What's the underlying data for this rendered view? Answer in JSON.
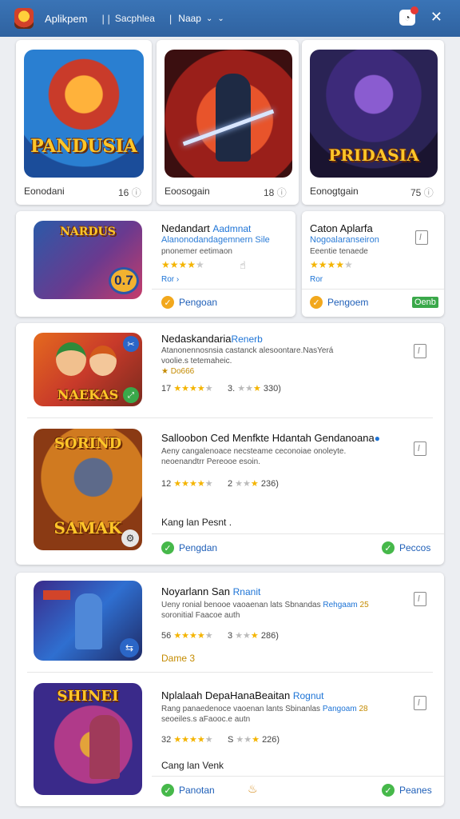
{
  "header": {
    "app_name": "Aplikpem",
    "separator": "| |",
    "nav_link": "Sacphlea",
    "nav_dropdown": "Naap",
    "dropdown_glyph": "⌄",
    "chevron": "⌄"
  },
  "featured": [
    {
      "name": "Eonodani",
      "count": "16",
      "art": "PANDUSIA"
    },
    {
      "name": "Eoosogain",
      "count": "18",
      "art": ""
    },
    {
      "name": "Eonogtgain",
      "count": "75",
      "art": "PRIDASIA"
    }
  ],
  "row2": {
    "left": {
      "title": "Nedandart",
      "title_accent": "Aadmnat",
      "subtitle": "Alanonodandagemnern  Sile",
      "desc": "pnonemer eetimaon",
      "stars_on": "★★★★",
      "stars_off": "★",
      "link": "Ror ›",
      "button": "Pengoan",
      "thumb_art": "NARDUS",
      "thumb_badge": "0.7"
    },
    "right": {
      "title": "Caton Aplarfa",
      "subtitle": "Nogoalaranseiron",
      "desc": "Eeentie tenaede",
      "stars_on": "★★★★",
      "stars_off": "★",
      "link": "Ror",
      "button": "Pengoem",
      "tag": "Oenb"
    }
  },
  "group1": {
    "items": [
      {
        "title": "Nedaskandaria",
        "title_accent": "Renerb",
        "desc1": "Atanonennosnsia castanck alesoontare.NasYerá",
        "desc2": "voolie.s tetemaheic.",
        "badge": "★ Do666",
        "rating": "17",
        "stars_on": "★★★★",
        "stars_off": "★",
        "second_rank": "3.",
        "second_count": "330)",
        "thumb_art": "NAEKAS"
      },
      {
        "title": "Salloobon Ced Menfkte Hdantah Gendanoana",
        "title_accent": "",
        "desc1": "Aeny cangalenoace necsteame ceconoiae onoleyte.",
        "desc2": "neoenandtrr Pereooe esoin.",
        "rating": "12",
        "stars_on": "★★★★",
        "stars_off": "★",
        "second_rank": "2",
        "second_count": "236)",
        "extra": "Kang lan Pesnt .",
        "thumb_art": "SAMAK",
        "thumb_art_top": "SORIND"
      }
    ],
    "buttons": {
      "left": "Pengdan",
      "right": "Peccos"
    }
  },
  "group2": {
    "items": [
      {
        "title": "Noyarlann San",
        "title_accent": "Rnanit",
        "desc1": "Ueny ronial benooe vaoaenan lats Sbnandas",
        "desc1_accent": "Rehgaam",
        "desc1_tail": "25",
        "desc2": "soronitial Faacoe auth",
        "rating": "56",
        "stars_on": "★★★★",
        "stars_off": "★",
        "second_rank": "3",
        "second_count": "286)",
        "extra": "Dame 3"
      },
      {
        "title": "Nplalaah DepaHanaBeaitan",
        "title_accent": "Rognut",
        "desc1": "Rang panaedenoce vaoenan lants Sbinanlas",
        "desc1_accent": "Pangoam",
        "desc1_tail": "28",
        "desc2": "seoeiles.s aFaooc.e autn",
        "rating": "32",
        "stars_on": "★★★★",
        "stars_off": "★",
        "second_rank": "S",
        "second_count": "226)",
        "extra": "Cang lan Venk",
        "thumb_art": "SHINEI"
      }
    ],
    "buttons": {
      "left": "Panotan",
      "right": "Peanes"
    }
  },
  "colors": {
    "accent": "#2f62a0",
    "link": "#1e74d6",
    "star": "#f4b400",
    "check": "#46b84a"
  }
}
